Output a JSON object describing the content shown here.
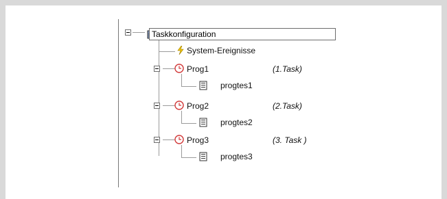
{
  "tree": {
    "root": {
      "label": "Taskkonfiguration",
      "icon": "task-config-icon"
    },
    "system_events": {
      "label": "System-Ereignisse",
      "icon": "lightning-icon"
    },
    "tasks": [
      {
        "name": "Prog1",
        "note": "(1.Task)",
        "child": "progtes1"
      },
      {
        "name": "Prog2",
        "note": "(2.Task)",
        "child": "progtes2"
      },
      {
        "name": "Prog3",
        "note": "(3. Task )",
        "child": "progtes3"
      }
    ]
  },
  "colors": {
    "frame": "#d9d9d9",
    "tree_line": "#9a9a9a",
    "clock": "#d23a3a",
    "lightning": "#f2c500"
  }
}
